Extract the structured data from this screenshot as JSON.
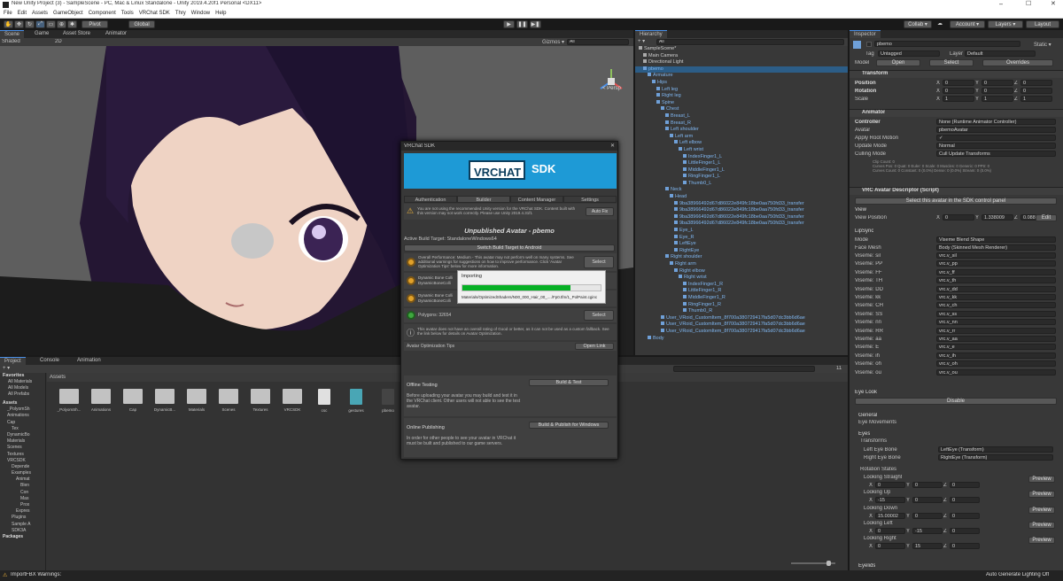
{
  "window": {
    "title": "New Unity Project (3) - SampleScene - PC, Mac & Linux Standalone - Unity 2019.4.20f1 Personal <DX11>"
  },
  "menu": [
    "File",
    "Edit",
    "Assets",
    "GameObject",
    "Component",
    "Tools",
    "VRChat SDK",
    "Thry",
    "Window",
    "Help"
  ],
  "toolbar": {
    "pivot": "Pivot",
    "global": "Global",
    "collab": "Collab ▾",
    "account": "Account ▾",
    "layers": "Layers ▾",
    "layout": "Layout"
  },
  "scene": {
    "tabs": [
      "Scene",
      "Game",
      "Asset Store",
      "Animator"
    ],
    "shading": "Shaded",
    "mode2d": "2D",
    "gizmos": "Gizmos ▾",
    "search": "All",
    "persp": "< Persp"
  },
  "hierarchy": {
    "tab": "Hierarchy",
    "search": "All",
    "items": [
      {
        "label": "SampleScene*",
        "d": 0,
        "c": "w"
      },
      {
        "label": "Main Camera",
        "d": 1,
        "c": "w"
      },
      {
        "label": "Directional Light",
        "d": 1,
        "c": "w"
      },
      {
        "label": "pbemo",
        "d": 1,
        "c": "b",
        "sel": true
      },
      {
        "label": "Armature",
        "d": 2,
        "c": "b"
      },
      {
        "label": "Hips",
        "d": 3,
        "c": "b"
      },
      {
        "label": "Left leg",
        "d": 4,
        "c": "b"
      },
      {
        "label": "Right leg",
        "d": 4,
        "c": "b"
      },
      {
        "label": "Spine",
        "d": 4,
        "c": "b"
      },
      {
        "label": "Chest",
        "d": 5,
        "c": "b"
      },
      {
        "label": "Breast_L",
        "d": 6,
        "c": "b"
      },
      {
        "label": "Breast_R",
        "d": 6,
        "c": "b"
      },
      {
        "label": "Left shoulder",
        "d": 6,
        "c": "b"
      },
      {
        "label": "Left arm",
        "d": 7,
        "c": "b"
      },
      {
        "label": "Left elbow",
        "d": 8,
        "c": "b"
      },
      {
        "label": "Left wrist",
        "d": 9,
        "c": "b"
      },
      {
        "label": "IndexFinger1_L",
        "d": 10,
        "c": "b"
      },
      {
        "label": "LittleFinger1_L",
        "d": 10,
        "c": "b"
      },
      {
        "label": "MiddleFinger1_L",
        "d": 10,
        "c": "b"
      },
      {
        "label": "RingFinger1_L",
        "d": 10,
        "c": "b"
      },
      {
        "label": "Thumb0_L",
        "d": 10,
        "c": "b"
      },
      {
        "label": "Neck",
        "d": 6,
        "c": "b"
      },
      {
        "label": "Head",
        "d": 7,
        "c": "b"
      },
      {
        "label": "9ba38966492d67d86022e849fc18be0aa750fd33_transfer",
        "d": 8,
        "c": "b"
      },
      {
        "label": "9ba38966492d67d86022e849fc18be0aa750fd33_transfer",
        "d": 8,
        "c": "b"
      },
      {
        "label": "9ba38966492d67d86022e849fc18be0aa750fd33_transfer",
        "d": 8,
        "c": "b"
      },
      {
        "label": "9ba38966492d67d86022e849fc18be0aa750fd33_transfer",
        "d": 8,
        "c": "b"
      },
      {
        "label": "Eye_L",
        "d": 8,
        "c": "b"
      },
      {
        "label": "Eye_R",
        "d": 8,
        "c": "b"
      },
      {
        "label": "LeftEye",
        "d": 8,
        "c": "b"
      },
      {
        "label": "RightEye",
        "d": 8,
        "c": "b"
      },
      {
        "label": "Right shoulder",
        "d": 6,
        "c": "b"
      },
      {
        "label": "Right arm",
        "d": 7,
        "c": "b"
      },
      {
        "label": "Right elbow",
        "d": 8,
        "c": "b"
      },
      {
        "label": "Right wrist",
        "d": 9,
        "c": "b"
      },
      {
        "label": "IndexFinger1_R",
        "d": 10,
        "c": "b"
      },
      {
        "label": "LittleFinger1_R",
        "d": 10,
        "c": "b"
      },
      {
        "label": "MiddleFinger1_R",
        "d": 10,
        "c": "b"
      },
      {
        "label": "RingFinger1_R",
        "d": 10,
        "c": "b"
      },
      {
        "label": "Thumb0_R",
        "d": 10,
        "c": "b"
      },
      {
        "label": "User_VRoid_CustomItem_8f700a380729417fa5d07dc3bb6d6ae",
        "d": 5,
        "c": "b"
      },
      {
        "label": "User_VRoid_CustomItem_8f700a380729417fa5d07dc3bb6d6ae",
        "d": 5,
        "c": "b"
      },
      {
        "label": "User_VRoid_CustomItem_8f700a380729417fa5d07dc3bb6d6ae",
        "d": 5,
        "c": "b"
      },
      {
        "label": "Body",
        "d": 2,
        "c": "b"
      }
    ]
  },
  "inspector": {
    "tab": "Inspector",
    "name": "pbemo",
    "static": "Static ▾",
    "tag_label": "Tag",
    "tag": "Untagged",
    "layer_label": "Layer",
    "layer": "Default",
    "model_label": "Model",
    "open": "Open",
    "select": "Select",
    "overrides": "Overrides",
    "transform": {
      "title": "Transform",
      "rows": [
        {
          "label": "Position",
          "v": [
            "0",
            "0",
            "0"
          ]
        },
        {
          "label": "Rotation",
          "v": [
            "0",
            "0",
            "0"
          ]
        },
        {
          "label": "Scale",
          "v": [
            "1",
            "1",
            "1"
          ]
        }
      ]
    },
    "animator": {
      "title": "Animator",
      "rows": [
        [
          "Controller",
          "None (Runtime Animator Controller)"
        ],
        [
          "Avatar",
          "pbemoAvatar"
        ],
        [
          "Apply Root Motion",
          "✓"
        ],
        [
          "Update Mode",
          "Normal"
        ],
        [
          "Culling Mode",
          "Cull Update Transforms"
        ]
      ],
      "info": [
        "Clip Count: 0",
        "Curves Pos: 0 Quat: 0 Euler: 0 Scale: 0 Muscles: 0 Generic: 0 PPtr: 0",
        "Curves Count: 0 Constant: 0 (0.0%) Dense: 0 (0.0%) Stream: 0 (0.0%)"
      ]
    },
    "descriptor": {
      "title": "VRC Avatar Descriptor (Script)",
      "select_btn": "Select this avatar in the SDK control panel",
      "view": "View",
      "view_position": "View Position",
      "vp": [
        "0",
        "1.338009",
        "0.088608"
      ],
      "edit": "Edit",
      "lipsync": "LipSync",
      "mode_label": "Mode",
      "mode": "Viseme Blend Shape",
      "face_mesh_label": "Face Mesh",
      "face_mesh": "Body (Skinned Mesh Renderer)",
      "visemes": [
        [
          "Viseme: sil",
          "vrc.v_sil"
        ],
        [
          "Viseme: PP",
          "vrc.v_pp"
        ],
        [
          "Viseme: FF",
          "vrc.v_ff"
        ],
        [
          "Viseme: TH",
          "vrc.v_th"
        ],
        [
          "Viseme: DD",
          "vrc.v_dd"
        ],
        [
          "Viseme: kk",
          "vrc.v_kk"
        ],
        [
          "Viseme: CH",
          "vrc.v_ch"
        ],
        [
          "Viseme: SS",
          "vrc.v_ss"
        ],
        [
          "Viseme: nn",
          "vrc.v_nn"
        ],
        [
          "Viseme: RR",
          "vrc.v_rr"
        ],
        [
          "Viseme: aa",
          "vrc.v_aa"
        ],
        [
          "Viseme: E",
          "vrc.v_e"
        ],
        [
          "Viseme: ih",
          "vrc.v_ih"
        ],
        [
          "Viseme: oh",
          "vrc.v_oh"
        ],
        [
          "Viseme: ou",
          "vrc.v_ou"
        ]
      ],
      "eyelook": "Eye Look",
      "disable": "Disable",
      "general": "General",
      "eye_movements": "Eye Movements",
      "eyes": "Eyes",
      "transforms": "Transforms",
      "left_eye_bone": "Left Eye Bone",
      "left_eye": "LeftEye (Transform)",
      "right_eye_bone": "Right Eye Bone",
      "right_eye": "RightEye (Transform)",
      "rotation_states": "Rotation States",
      "states": [
        {
          "label": "Looking Straight",
          "v": [
            "0",
            "0",
            "0"
          ]
        },
        {
          "label": "Looking Up",
          "v": [
            "-15",
            "0",
            "0"
          ]
        },
        {
          "label": "Looking Down",
          "v": [
            "15.00002",
            "0",
            "0"
          ]
        },
        {
          "label": "Looking Left",
          "v": [
            "0",
            "-15",
            "0"
          ]
        },
        {
          "label": "Looking Right",
          "v": [
            "0",
            "15",
            "0"
          ]
        }
      ],
      "preview": "Preview",
      "eyelids": "Eyelids"
    }
  },
  "sdk": {
    "title": "VRChat SDK",
    "logo_a": "VRCHAT",
    "logo_b": "SDK",
    "tabs": [
      "Authentication",
      "Builder",
      "Content Manager",
      "Settings"
    ],
    "warn": "You are not using the recommended Unity version for the VRChat SDK. Content built with this version may not work correctly. Please use Unity 2019.4.31f1",
    "autofix": "Auto Fix",
    "avatar_title": "Unpublished Avatar - pbemo",
    "build_target": "Active Build Target: StandaloneWindows64",
    "switch": "Switch Build Target to Android",
    "perf": "Overall Performance: Medium - This avatar may not perform well on many systems. See additional warnings for suggestions on how to improve performance. Click 'Avatar Optimization Tips' below for more information.",
    "dyn1": "Dynamic Bone Colli",
    "dyn1b": "DynamicBoneColli",
    "dyn2": "Dynamic Bone Colli",
    "dyn2b": "DynamicBoneColli",
    "polygons": "Polygons: 32654",
    "good": "This avatar does not have an overall rating of Good or better, as it can not be used as a custom fallback. See the link below for details on Avatar Optimization.",
    "tips": "Avatar Optimization Tips",
    "open_link": "Open Link",
    "offline": "Offline Testing",
    "build_test": "Build & Test",
    "offline_desc": "Before uploading your avatar you may build and test it in the VRChat client. Other users will not able to see the test avatar.",
    "online": "Online Publishing",
    "build_publish": "Build & Publish for Windows",
    "online_desc": "In order for other people to see your avatar in VRChat it must be built and published to our game servers."
  },
  "importing": {
    "title": "Importing",
    "path": "Materials/OptimizedShaders/N00_000_Hair_00_..../Fp0.tfm/1_PolPaint.cginc",
    "progress": 0.78
  },
  "project": {
    "tabs": [
      "Project",
      "Console",
      "Animation"
    ],
    "favorites": "Favorites",
    "favs": [
      "All Materials",
      "All Models",
      "All Prefabs"
    ],
    "tree": [
      [
        "Assets",
        0
      ],
      [
        "_PolyomSh",
        1
      ],
      [
        "Animations",
        1
      ],
      [
        "Cap",
        1
      ],
      [
        "Tex",
        2
      ],
      [
        "DynamicBo",
        1
      ],
      [
        "Materials",
        1
      ],
      [
        "Scenes",
        1
      ],
      [
        "Textures",
        1
      ],
      [
        "VRCSDK",
        1
      ],
      [
        "Depende",
        2
      ],
      [
        "Examples",
        2
      ],
      [
        "Animat",
        3
      ],
      [
        "Blen",
        4
      ],
      [
        "Con",
        4
      ],
      [
        "Mas",
        4
      ],
      [
        "Prox",
        4
      ],
      [
        "Expres",
        3
      ],
      [
        "Plugins",
        2
      ],
      [
        "Sample A",
        2
      ],
      [
        "SDK3A",
        2
      ],
      [
        "Packages",
        0
      ]
    ],
    "crumb": "Assets",
    "assets": [
      "_PolyomSh...",
      "Animations",
      "Cap",
      "DynamicB...",
      "Materials",
      "Scenes",
      "Textures",
      "VRCSDK",
      "csc",
      "gestures",
      "pbemo"
    ],
    "count": "11"
  },
  "status": {
    "left": "ImportFBX Warnings:",
    "right": "Auto Generate Lighting Off"
  },
  "colors": {
    "accent": "#3a72b0",
    "sdk_blue": "#1e9ad6",
    "progress": "#06b025"
  }
}
